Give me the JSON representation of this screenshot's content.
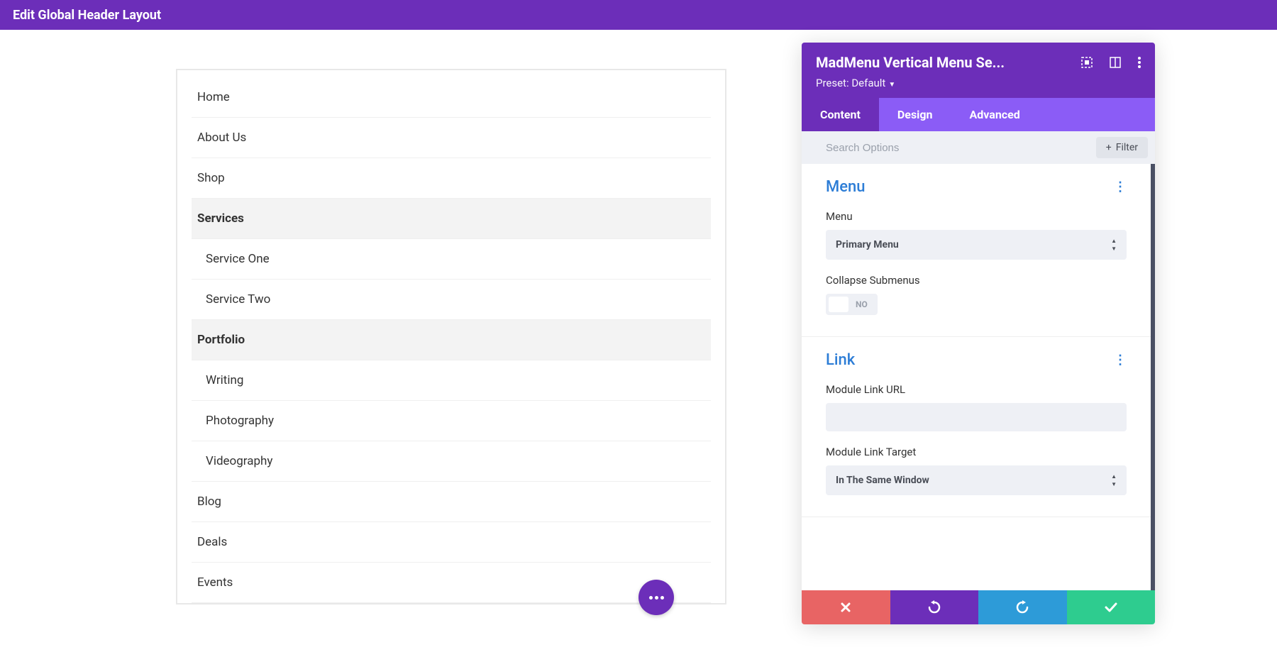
{
  "topBar": {
    "title": "Edit Global Header Layout"
  },
  "preview": {
    "menuItems": [
      {
        "label": "Home",
        "class": ""
      },
      {
        "label": "About Us",
        "class": ""
      },
      {
        "label": "Shop",
        "class": ""
      },
      {
        "label": "Services",
        "class": "parent"
      },
      {
        "label": "Service One",
        "class": "sub"
      },
      {
        "label": "Service Two",
        "class": "sub"
      },
      {
        "label": "Portfolio",
        "class": "parent"
      },
      {
        "label": "Writing",
        "class": "sub"
      },
      {
        "label": "Photography",
        "class": "sub"
      },
      {
        "label": "Videography",
        "class": "sub"
      },
      {
        "label": "Blog",
        "class": ""
      },
      {
        "label": "Deals",
        "class": ""
      },
      {
        "label": "Events",
        "class": ""
      }
    ]
  },
  "panel": {
    "title": "MadMenu Vertical Menu Se...",
    "presetPrefix": "Preset: ",
    "presetValue": "Default",
    "tabs": {
      "content": "Content",
      "design": "Design",
      "advanced": "Advanced"
    },
    "search": {
      "placeholder": "Search Options",
      "filterLabel": "Filter"
    },
    "sections": {
      "menu": {
        "title": "Menu",
        "menuFieldLabel": "Menu",
        "menuFieldValue": "Primary Menu",
        "collapseLabel": "Collapse Submenus",
        "collapseValue": "NO"
      },
      "link": {
        "title": "Link",
        "urlLabel": "Module Link URL",
        "urlValue": "",
        "targetLabel": "Module Link Target",
        "targetValue": "In The Same Window"
      }
    }
  }
}
